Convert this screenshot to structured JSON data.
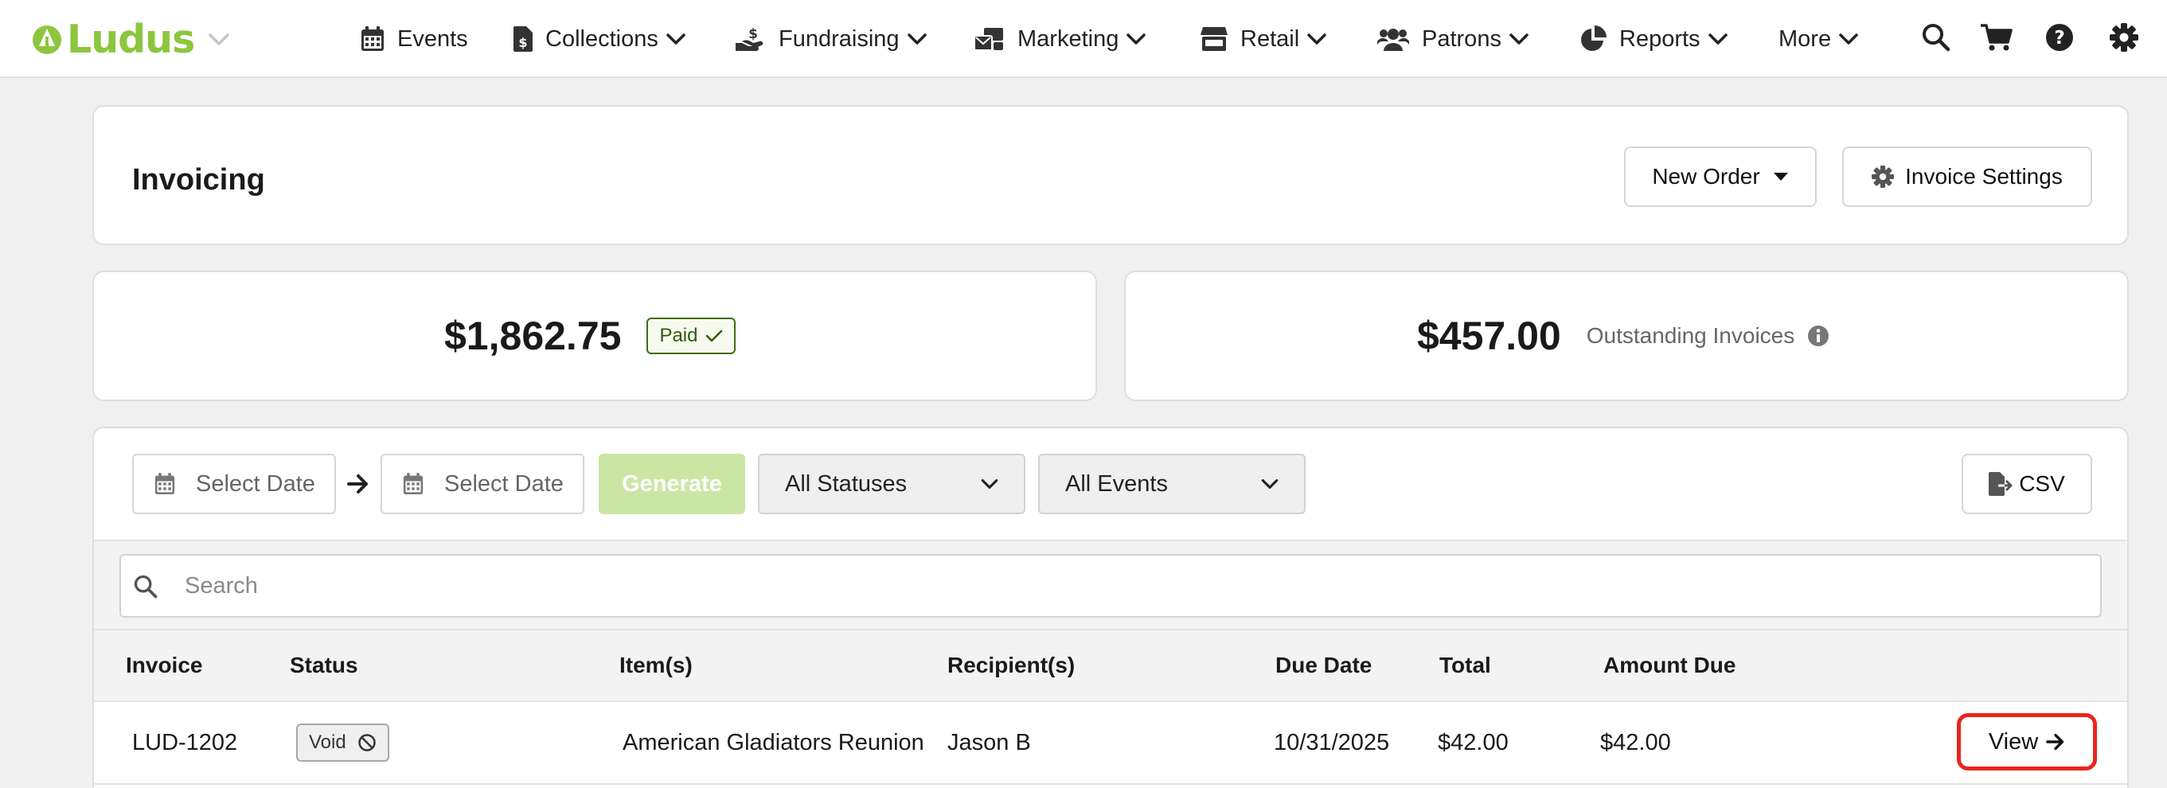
{
  "brand": {
    "name": "Ludus",
    "accent": "#8cc63f"
  },
  "nav": {
    "items": [
      {
        "label": "Events",
        "icon": "calendar-icon",
        "dropdown": false
      },
      {
        "label": "Collections",
        "icon": "dollar-file-icon",
        "dropdown": true
      },
      {
        "label": "Fundraising",
        "icon": "hand-dollar-icon",
        "dropdown": true
      },
      {
        "label": "Marketing",
        "icon": "mail-bulk-icon",
        "dropdown": true
      },
      {
        "label": "Retail",
        "icon": "store-icon",
        "dropdown": true
      },
      {
        "label": "Patrons",
        "icon": "users-icon",
        "dropdown": true
      },
      {
        "label": "Reports",
        "icon": "pie-chart-icon",
        "dropdown": true
      },
      {
        "label": "More",
        "icon": "",
        "dropdown": true
      }
    ],
    "tools": [
      "search-icon",
      "cart-icon",
      "help-icon",
      "gear-icon"
    ]
  },
  "header": {
    "title": "Invoicing",
    "new_order_label": "New Order",
    "settings_label": "Invoice Settings"
  },
  "stats": {
    "paid_amount": "$1,862.75",
    "paid_badge": "Paid",
    "outstanding_amount": "$457.00",
    "outstanding_label": "Outstanding Invoices"
  },
  "filters": {
    "start_date_placeholder": "Select Date",
    "end_date_placeholder": "Select Date",
    "generate_label": "Generate",
    "status_select": "All Statuses",
    "events_select": "All Events",
    "csv_label": "CSV",
    "generate_color": "#cbe6a4"
  },
  "search": {
    "placeholder": "Search",
    "value": ""
  },
  "table": {
    "columns": [
      "Invoice",
      "Status",
      "Item(s)",
      "Recipient(s)",
      "Due Date",
      "Total",
      "Amount Due"
    ],
    "rows": [
      {
        "invoice": "LUD-1202",
        "status": "Void",
        "items": "American Gladiators Reunion",
        "recipients": "Jason B",
        "due_date": "10/31/2025",
        "total": "$42.00",
        "amount_due": "$42.00",
        "action_label": "View"
      }
    ]
  },
  "highlight_color": "#e8261b"
}
